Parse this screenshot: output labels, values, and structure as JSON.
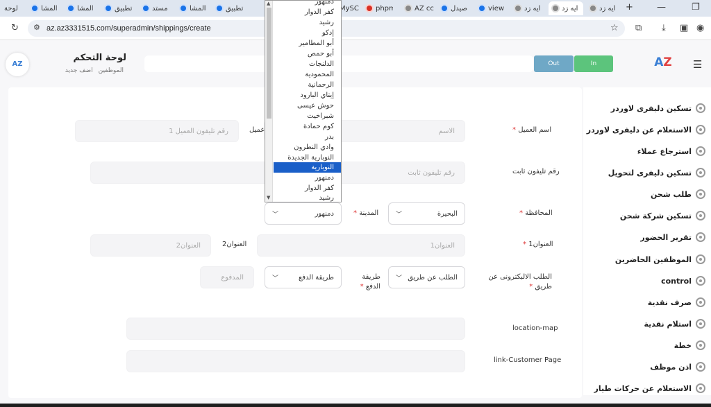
{
  "browser": {
    "tabs": [
      {
        "label": "ايه زد"
      },
      {
        "label": "ايه زد"
      },
      {
        "label": "ايه زد"
      },
      {
        "label": "view"
      },
      {
        "label": "صيدل"
      },
      {
        "label": "AZ cc"
      },
      {
        "label": "phpm"
      },
      {
        "label": "MySC"
      },
      {
        "label": "تطبيق"
      },
      {
        "label": "المشا"
      },
      {
        "label": "مستد"
      },
      {
        "label": "تطبيق"
      },
      {
        "label": "المشا"
      },
      {
        "label": "المشا"
      },
      {
        "label": "لوحة"
      }
    ],
    "url": "az.az3331515.com/superadmin/shippings/create"
  },
  "header": {
    "out_label": "Out",
    "in_label": "In",
    "logo_text": "AZ",
    "page_title": "لوحة التحكم",
    "breadcrumb": [
      "الموظفين",
      "اضف جديد"
    ]
  },
  "sidebar": {
    "items": [
      {
        "label": "تسكين دليفرى لاوردر"
      },
      {
        "label": "الاستعلام عن دليفرى لاوردر"
      },
      {
        "label": "استرجاع عملاء"
      },
      {
        "label": "تسكين دليفرى لتحويل"
      },
      {
        "label": "طلب شحن"
      },
      {
        "label": "تسكين شركة شحن"
      },
      {
        "label": "تقرير الحضور"
      },
      {
        "label": "الموظفين الحاضرين"
      },
      {
        "label": "control"
      },
      {
        "label": "صرف نقدية"
      },
      {
        "label": "استلام نقدية"
      },
      {
        "label": "خطة"
      },
      {
        "label": "اذن موظف"
      },
      {
        "label": "الاستعلام عن حركات طيار"
      }
    ]
  },
  "form": {
    "customer_name_label": "اسم العميل",
    "customer_name_placeholder": "الاسم",
    "customer_phone_partial_label": "عميل",
    "customer_phone_placeholder": "رقم تليفون العميل 1",
    "landline_label": "رقم تليفون ثابت",
    "landline_placeholder": "رقم تليفون ثابت",
    "governorate_label": "المحافظة",
    "governorate_value": "البحيرة",
    "city_label": "المدينة",
    "city_value": "دمنهور",
    "address1_label": "العنوان1",
    "address1_placeholder": "العنوان1",
    "address2_label": "العنوان2",
    "address2_placeholder": "العنوان2",
    "order_via_label": "الطلب الالبكترونى عن طريق",
    "order_via_value": "الطلب عن طريق",
    "payment_method_label": "طريقة الدفع",
    "payment_method_value": "طريقة الدفع",
    "paid_placeholder": "المدفوع",
    "location_map_label": "location-map",
    "customer_page_label": "link-Customer Page",
    "required_mark": "*"
  },
  "city_dropdown": {
    "options": [
      "دمنهور",
      "كفر الدوار",
      "رشيد",
      "إدكو",
      "أبو المطامير",
      "أبو حمص",
      "الدلنجات",
      "المحمودية",
      "الرحمانية",
      "إيتاي البارود",
      "حوش عيسى",
      "شبراخيت",
      "كوم حمادة",
      "بدر",
      "وادي النطرون",
      "النوبارية الجديدة",
      "النوبارية",
      "دمنهور",
      "كفر الدوار",
      "رشيد"
    ],
    "selected": "النوبارية"
  }
}
